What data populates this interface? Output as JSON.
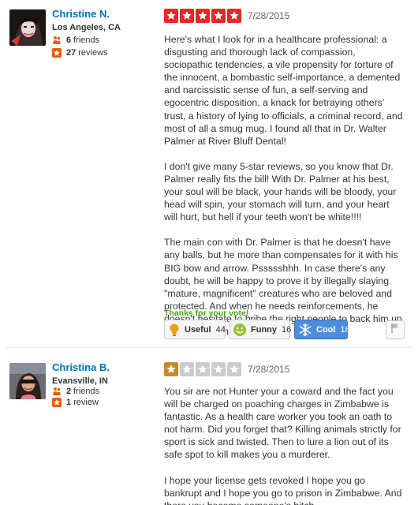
{
  "reviews": [
    {
      "user": {
        "name": "Christine N.",
        "location": "Los Angeles, CA",
        "friends_count": "6",
        "friends_label": "friends",
        "reviews_count": "27",
        "reviews_label": "reviews"
      },
      "rating": 5,
      "date": "7/28/2015",
      "paragraphs": [
        "Here's what I look for in a healthcare professional:  a disgusting and thorough lack of compassion, sociopathic tendencies, a vile propensity for torture of the innocent, a bombastic self-importance, a demented and narcissistic sense of fun, a self-serving and egocentric disposition, a knack for betraying others' trust, a history of lying to officials, a criminal record, and most of all a smug mug. I found all that in Dr. Walter Palmer at River Bluff Dental!",
        "I don't give many 5-star reviews, so you know that Dr. Palmer really fits the bill!  With Dr. Palmer at his best, your soul will be black, your hands will be bloody, your head will spin, your stomach will turn, and your heart will hurt, but hell if your teeth won't be white!!!!",
        "The main con with Dr. Palmer is that he doesn't have any balls, but he more than compensates for it with his BIG bow and arrow.  Pssssshhh. In case there's any doubt, he will be happy to prove it by illegally slaying \"mature, magnificent\" creatures who are beloved and protected. And when he needs reinforcements, he doesn't hesitate to bribe the right people to back him up. Highly recommended!"
      ],
      "thanks_text": "Thanks for your vote!",
      "votes": {
        "useful": {
          "label": "Useful",
          "count": "44"
        },
        "funny": {
          "label": "Funny",
          "count": "16"
        },
        "cool": {
          "label": "Cool",
          "count": "16"
        }
      }
    },
    {
      "user": {
        "name": "Christina B.",
        "location": "Evansville, IN",
        "friends_count": "2",
        "friends_label": "friends",
        "reviews_count": "1",
        "reviews_label": "review"
      },
      "rating": 1,
      "date": "7/28/2015",
      "paragraphs": [
        "You sir are not Hunter your a coward and the fact you will be charged on poaching charges in Zimbabwe is fantastic. As a health care worker you took an oath to not harm. Did you forget that? Killing animals strictly for sport is sick and twisted. Then to lure a lion out of its safe spot to kill makes you a murderer.",
        "I hope your license gets revoked I hope you go bankrupt and I hope you go to prison in Zimbabwe. And there you become someone's bitch"
      ]
    }
  ],
  "colors": {
    "user_link": "#0073bb",
    "star_five": "#e6262a",
    "star_one": "#c9892b",
    "star_empty": "#cccccc",
    "thanks": "#41a700",
    "cool_active": "#4d8ddb"
  },
  "icons": {
    "friends": "friends-icon",
    "reviews": "review-star-icon",
    "useful": "lightbulb-icon",
    "funny": "smiley-icon",
    "cool": "snowflake-icon",
    "flag": "flag-icon"
  }
}
